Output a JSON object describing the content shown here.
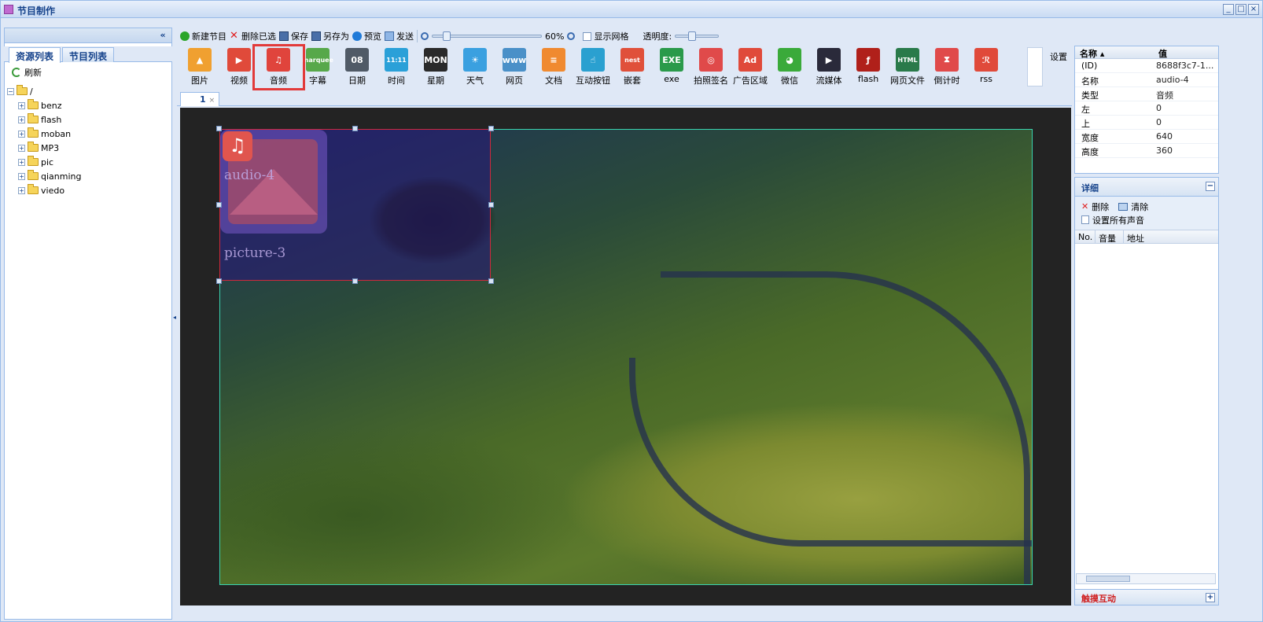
{
  "window": {
    "title": "节目制作",
    "controls": [
      "_",
      "□",
      "×"
    ]
  },
  "left_panel": {
    "collapse_glyph": "«",
    "tabs": [
      {
        "label": "资源列表",
        "active": true
      },
      {
        "label": "节目列表",
        "active": false
      }
    ],
    "refresh_label": "刷新",
    "tree_root": "/",
    "folders": [
      "benz",
      "flash",
      "moban",
      "MP3",
      "pic",
      "qianming",
      "viedo"
    ]
  },
  "toolbar": {
    "new_label": "新建节目",
    "delete_label": "删除已选",
    "save_label": "保存",
    "save_as_label": "另存为",
    "preview_label": "预览",
    "send_label": "发送",
    "zoom_value": "60%",
    "zoom_fraction": 0.1,
    "show_grid_label": "显示网格",
    "opacity_label": "透明度:",
    "opacity_fraction": 0.35
  },
  "resources": [
    {
      "label": "图片",
      "icon": "picture-icon",
      "color": "#f0a030",
      "glyph": "▲"
    },
    {
      "label": "视频",
      "icon": "video-icon",
      "color": "#e04a3a",
      "glyph": "▶"
    },
    {
      "label": "音频",
      "icon": "audio-icon",
      "color": "#e0443c",
      "glyph": "♫"
    },
    {
      "label": "字幕",
      "icon": "marquee-icon",
      "color": "#57a84a",
      "glyph": "marquee"
    },
    {
      "label": "日期",
      "icon": "calendar-icon",
      "color": "#505a66",
      "glyph": "08"
    },
    {
      "label": "时间",
      "icon": "clock-icon",
      "color": "#2aa0d8",
      "glyph": "11:11"
    },
    {
      "label": "星期",
      "icon": "weekday-icon",
      "color": "#2a2a2a",
      "glyph": "MON"
    },
    {
      "label": "天气",
      "icon": "weather-icon",
      "color": "#3aa0e0",
      "glyph": "☀"
    },
    {
      "label": "网页",
      "icon": "web-icon",
      "color": "#4a90c8",
      "glyph": "www"
    },
    {
      "label": "文档",
      "icon": "document-icon",
      "color": "#f08a30",
      "glyph": "≡"
    },
    {
      "label": "互动按钮",
      "icon": "touch-button-icon",
      "color": "#2aa0d0",
      "glyph": "☝"
    },
    {
      "label": "嵌套",
      "icon": "nesting-icon",
      "color": "#e0503a",
      "glyph": "nest"
    },
    {
      "label": "exe",
      "icon": "exe-icon",
      "color": "#2a9a4a",
      "glyph": "EXE"
    },
    {
      "label": "拍照签名",
      "icon": "photo-sign-icon",
      "color": "#e04a4a",
      "glyph": "◎"
    },
    {
      "label": "广告区域",
      "icon": "ad-icon",
      "color": "#e04a3a",
      "glyph": "Ad"
    },
    {
      "label": "微信",
      "icon": "wechat-icon",
      "color": "#3aaa3a",
      "glyph": "◕"
    },
    {
      "label": "流媒体",
      "icon": "stream-icon",
      "color": "#2a2a3a",
      "glyph": "▶"
    },
    {
      "label": "flash",
      "icon": "flash-icon",
      "color": "#b0201a",
      "glyph": "ƒ"
    },
    {
      "label": "网页文件",
      "icon": "html-icon",
      "color": "#2a7a4a",
      "glyph": "HTML"
    },
    {
      "label": "倒计时",
      "icon": "countdown-icon",
      "color": "#e04a4a",
      "glyph": "⧗"
    },
    {
      "label": "rss",
      "icon": "rss-icon",
      "color": "#e04a3a",
      "glyph": "ℛ"
    }
  ],
  "settings_label": "设置",
  "editor": {
    "tab_label": "1",
    "tab_close": "×",
    "audio_element_label": "audio-4",
    "picture_element_label": "picture-3"
  },
  "properties": {
    "header_name": "名称 ▴",
    "header_value": "值",
    "rows": [
      {
        "key": "(ID)",
        "value": "8688f3c7-1..."
      },
      {
        "key": "名称",
        "value": "audio-4"
      },
      {
        "key": "类型",
        "value": "音频"
      },
      {
        "key": "左",
        "value": "0"
      },
      {
        "key": "上",
        "value": "0"
      },
      {
        "key": "宽度",
        "value": "640"
      },
      {
        "key": "高度",
        "value": "360"
      }
    ]
  },
  "detail": {
    "title": "详细",
    "collapse_glyph": "−",
    "delete_label": "删除",
    "clear_label": "清除",
    "set_all_sound_label": "设置所有声音",
    "columns": [
      "No.",
      "音量",
      "地址"
    ]
  },
  "touch_panel": {
    "title": "触摸互动",
    "expand_glyph": "+"
  }
}
